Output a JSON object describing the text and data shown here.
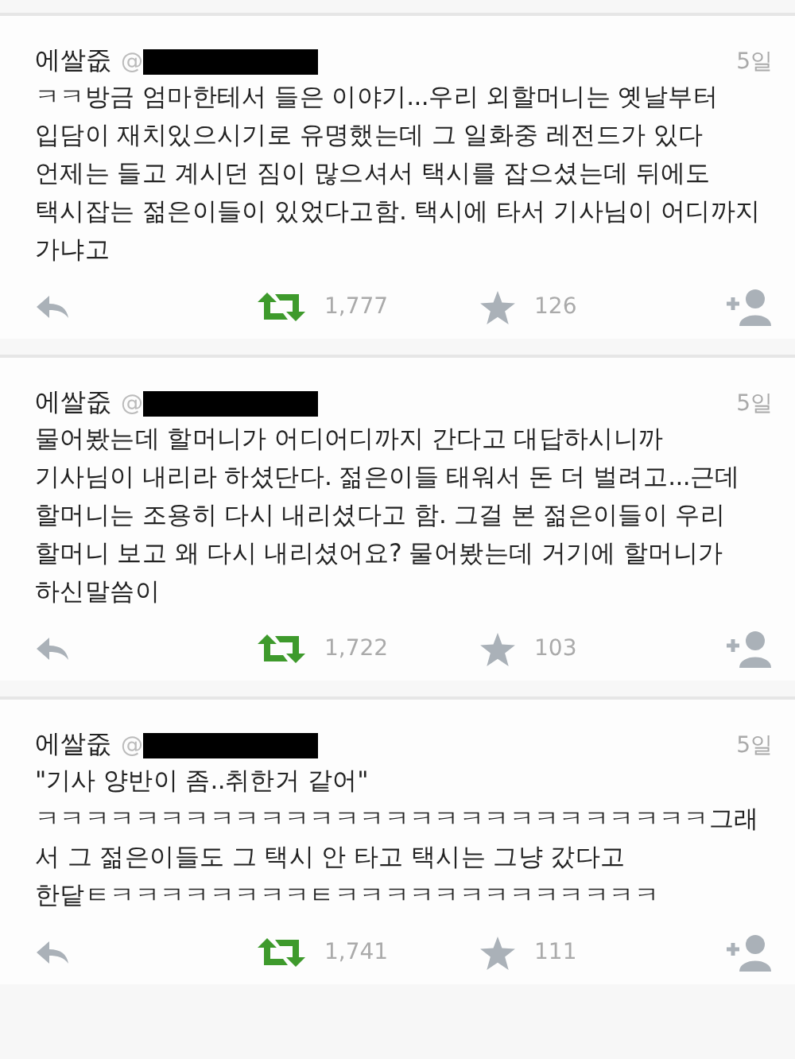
{
  "tweets": [
    {
      "name": "에쌀줎",
      "handle": "@",
      "time": "5일",
      "text": "ㅋㅋ방금 엄마한테서 들은 이야기...우리 외할머니는 옛날부터\n입담이 재치있으시기로 유명했는데 그 일화중 레전드가 있다\n언제는 들고 계시던 짐이 많으셔서 택시를 잡으셨는데 뒤에도\n택시잡는 젊은이들이 있었다고함. 택시에 타서 기사님이 어디까지\n가냐고",
      "retweets": "1,777",
      "retweeted": true,
      "favorites": "126",
      "favorited": false
    },
    {
      "name": "에쌀줎",
      "handle": "@",
      "time": "5일",
      "text": "물어봤는데 할머니가 어디어디까지 간다고 대답하시니까\n기사님이 내리라 하셨단다. 젊은이들 태워서 돈 더 벌려고...근데\n할머니는 조용히 다시 내리셨다고 함. 그걸 본 젊은이들이 우리\n할머니 보고 왜 다시 내리셨어요? 물어봤는데 거기에 할머니가\n하신말씀이",
      "retweets": "1,722",
      "retweeted": true,
      "favorites": "103",
      "favorited": false
    },
    {
      "name": "에쌀줎",
      "handle": "@",
      "time": "5일",
      "text": "\"기사 양반이 좀..취한거 같어\"\nㅋㅋㅋㅋㅋㅋㅋㅋㅋㅋㅋㅋㅋㅋㅋㅋㅋㅋㅋㅋㅋㅋㅋㅋㅋㅋㅋ그래\n서 그 젊은이들도 그 택시 안 타고 택시는 그냥 갔다고\n한닽ㅌㅋㅋㅋㅋㅋㅋㅋㅋㅌㅋㅋㅋㅋㅋㅋㅋㅋㅋㅋㅋㅋㅋ",
      "retweets": "1,741",
      "retweeted": true,
      "favorites": "111",
      "favorited": false
    }
  ]
}
